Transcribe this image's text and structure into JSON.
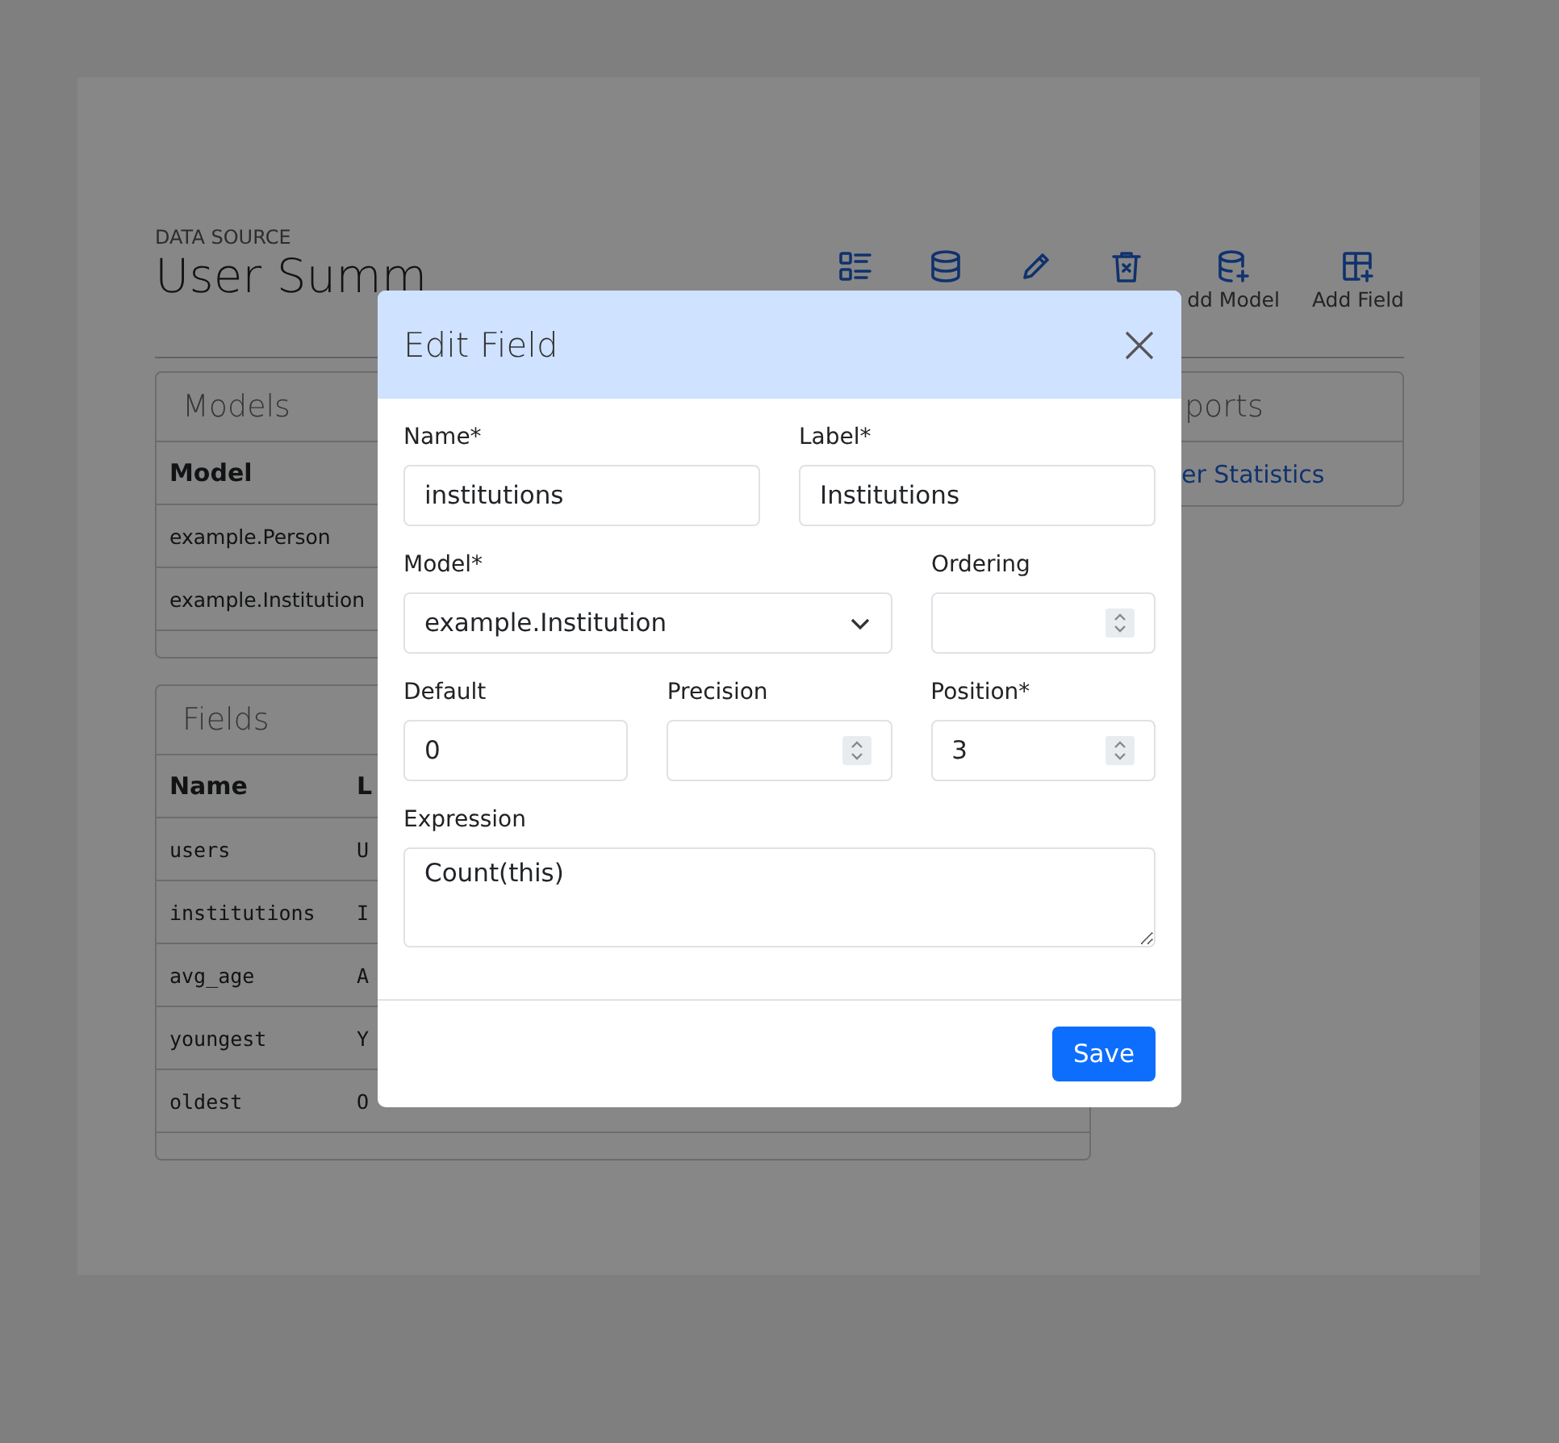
{
  "page": {
    "eyebrow": "DATA SOURCE",
    "title": "User Summ",
    "toolbar": [
      "dd Model",
      "Add Field"
    ],
    "models": {
      "title": "Models",
      "columns": [
        "Model"
      ],
      "rows": [
        [
          "example.Person"
        ],
        [
          "example.Institution"
        ]
      ]
    },
    "fields": {
      "title": "Fields",
      "columns": [
        "Name",
        "L"
      ],
      "rows": [
        [
          "users",
          "U"
        ],
        [
          "institutions",
          "I"
        ],
        [
          "avg_age",
          "A"
        ],
        [
          "youngest",
          "Y"
        ],
        [
          "oldest",
          "O"
        ]
      ]
    },
    "reports": {
      "title": "ports",
      "links": [
        "er Statistics"
      ]
    }
  },
  "dialog": {
    "title": "Edit Field",
    "rows": [
      [
        {
          "kind": "text",
          "label": "Name*",
          "value": "institutions"
        },
        {
          "kind": "text",
          "label": "Label*",
          "value": "Institutions"
        }
      ],
      [
        {
          "kind": "select",
          "label": "Model*",
          "value": "example.Institution"
        },
        {
          "kind": "number",
          "label": "Ordering"
        }
      ],
      [
        {
          "kind": "text",
          "label": "Default",
          "value": "0"
        },
        {
          "kind": "number",
          "label": "Precision"
        },
        {
          "kind": "number",
          "label": "Position*",
          "value": "3"
        }
      ],
      [
        {
          "kind": "textarea",
          "label": "Expression",
          "value": "Count(this)"
        }
      ]
    ],
    "button": "Save"
  }
}
